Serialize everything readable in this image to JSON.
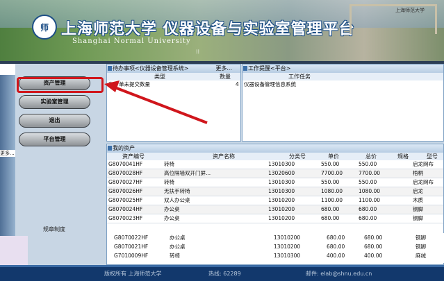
{
  "header": {
    "logo_text": "师",
    "title": "上海师范大学 仪器设备与实验室管理平台",
    "subtitle": "Shanghai Normal University",
    "gate_text": "上海师范大学",
    "grip": "⁞⁞"
  },
  "sidebar": {
    "more": "更多...",
    "buttons": [
      "资产管理",
      "实验室管理",
      "退出",
      "平台管理"
    ],
    "rules": "规章制度"
  },
  "todo": {
    "title": "待办事项<仪器设备管理系统>",
    "more": "更多...",
    "col_type": "类型",
    "col_count": "数量",
    "rows": [
      {
        "type": "资产单未提交数量",
        "count": "4"
      }
    ]
  },
  "reminder": {
    "title": "工作提醒<平台>",
    "col_task": "工作任务",
    "rows": [
      {
        "task": "仪器设备管理信息系统"
      }
    ]
  },
  "assets": {
    "title": "我的资产",
    "columns": [
      "资产编号",
      "资产名称",
      "分类号",
      "单价",
      "总价",
      "规格",
      "型号"
    ],
    "rows": [
      [
        "G8070041HF",
        "转椅",
        "13010300",
        "550.00",
        "550.00",
        "",
        "启龙网布"
      ],
      [
        "G8070028HF",
        "高位隔墙双开门屏...",
        "13020600",
        "7700.00",
        "7700.00",
        "",
        "梧桐"
      ],
      [
        "G8070027HF",
        "转椅",
        "13010300",
        "550.00",
        "550.00",
        "",
        "启龙网布"
      ],
      [
        "G8070026HF",
        "无扶手转椅",
        "13010300",
        "1080.00",
        "1080.00",
        "",
        "启龙"
      ],
      [
        "G8070025HF",
        "双人办公桌",
        "13010200",
        "1100.00",
        "1100.00",
        "",
        "木质"
      ],
      [
        "G8070024HF",
        "办公桌",
        "13010200",
        "680.00",
        "680.00",
        "",
        "钢脚"
      ],
      [
        "G8070023HF",
        "办公桌",
        "13010200",
        "680.00",
        "680.00",
        "",
        "钢脚"
      ]
    ],
    "under_rows": [
      [
        "G8070022HF",
        "办公桌",
        "13010200",
        "680.00",
        "680.00",
        "",
        "钢脚"
      ],
      [
        "G8070021HF",
        "办公桌",
        "13010200",
        "680.00",
        "680.00",
        "",
        "钢脚"
      ],
      [
        "G7010009HF",
        "转椅",
        "13010300",
        "400.00",
        "400.00",
        "",
        "麻绒"
      ]
    ]
  },
  "footer": {
    "copyright": "版权所有 上海师范大学",
    "hotline": "热线: 62289",
    "email": "邮件: elab@shnu.edu.cn"
  },
  "colors": {
    "accent_red": "#d0161c",
    "footer_bg": "#12386c",
    "panel_border": "#7ea1c4"
  }
}
